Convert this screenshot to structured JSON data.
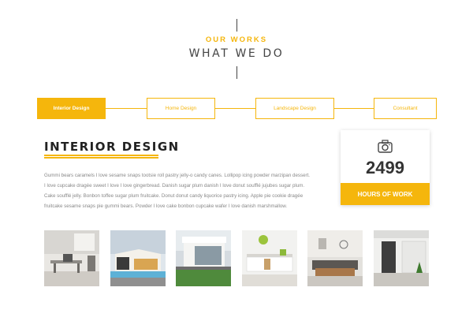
{
  "header": {
    "eyebrow": "OUR WORKS",
    "title": "WHAT WE DO"
  },
  "tabs": [
    {
      "label": "Interior Design",
      "active": true
    },
    {
      "label": "Home Design",
      "active": false
    },
    {
      "label": "Landscape Design",
      "active": false
    },
    {
      "label": "Consultant",
      "active": false
    }
  ],
  "section": {
    "title": "INTERIOR DESIGN",
    "body": "Gummi bears caramels I love sesame snaps tootsie roll pastry jelly-o candy canes. Lollipop icing powder marzipan dessert. I love cupcake dragée sweet I love I love gingerbread. Danish sugar plum danish I love donut soufflé jujubes sugar plum. Cake soufflé jelly. Bonbon toffee sugar plum fruitcake. Donut donut candy liquorice pastry icing. Apple pie cookie dragée fruitcake sesame snaps pie gummi bears. Powder I love cake bonbon cupcake wafer I love danish marshmallow."
  },
  "stat": {
    "icon": "camera-icon",
    "number": "2499",
    "label": "HOURS OF WORK"
  },
  "gallery": [
    {
      "name": "office-interior"
    },
    {
      "name": "modern-house-pool"
    },
    {
      "name": "glass-house-exterior"
    },
    {
      "name": "white-kitchen"
    },
    {
      "name": "living-room"
    },
    {
      "name": "house-entrance"
    }
  ],
  "colors": {
    "accent": "#f5b60c",
    "text_dark": "#333333",
    "text_muted": "#888888"
  }
}
